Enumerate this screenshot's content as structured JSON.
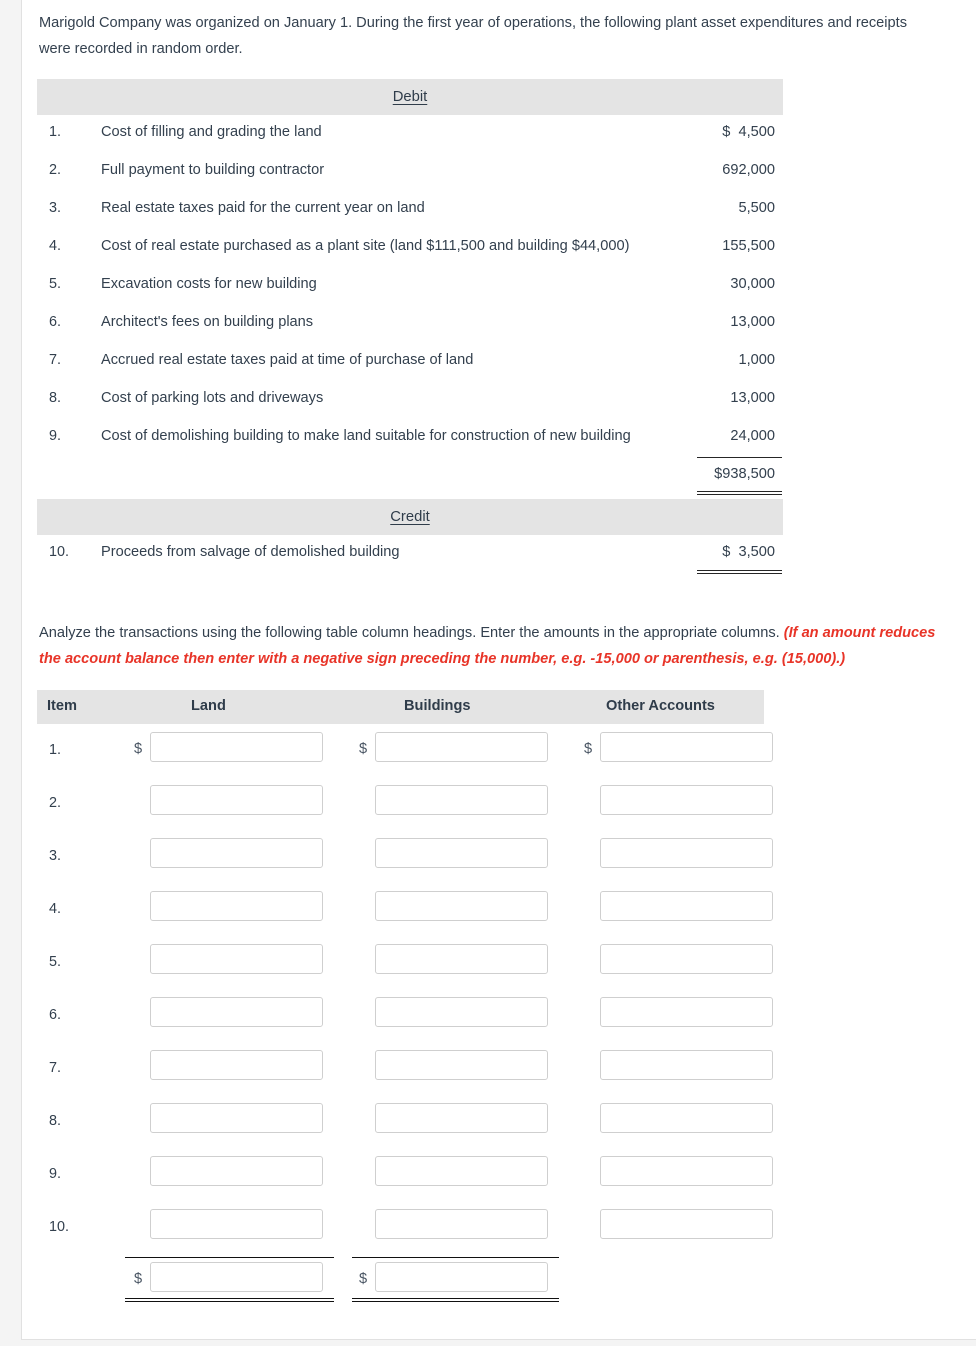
{
  "intro": "Marigold Company was organized on January 1. During the first year of operations, the following plant asset expenditures and receipts were recorded in random order.",
  "listing": {
    "debit_header": "Debit",
    "credit_header": "Credit",
    "debit_rows": [
      {
        "num": "1.",
        "text": "Cost of filling and grading the land",
        "amount": "$  4,500"
      },
      {
        "num": "2.",
        "text": "Full payment to building contractor",
        "amount": "692,000"
      },
      {
        "num": "3.",
        "text": "Real estate taxes paid for the current year on land",
        "amount": "5,500"
      },
      {
        "num": "4.",
        "text": "Cost of real estate purchased as a plant site (land $111,500 and building $44,000)",
        "amount": "155,500"
      },
      {
        "num": "5.",
        "text": "Excavation costs for new building",
        "amount": "30,000"
      },
      {
        "num": "6.",
        "text": "Architect's fees on building plans",
        "amount": "13,000"
      },
      {
        "num": "7.",
        "text": "Accrued real estate taxes paid at time of purchase of land",
        "amount": "1,000"
      },
      {
        "num": "8.",
        "text": "Cost of parking lots and driveways",
        "amount": "13,000"
      },
      {
        "num": "9.",
        "text": "Cost of demolishing building to make land suitable for construction of new building",
        "amount": "24,000"
      }
    ],
    "debit_total": "$938,500",
    "credit_rows": [
      {
        "num": "10.",
        "text": "Proceeds from salvage of demolished building",
        "amount": "$  3,500"
      }
    ]
  },
  "analyze": {
    "text": "Analyze the transactions using the following table column headings. Enter the amounts in the appropriate columns.",
    "note": "(If an amount reduces the account balance then enter with a negative sign preceding the number, e.g. -15,000 or parenthesis, e.g. (15,000).)",
    "note_color": "#e83428"
  },
  "entry_table": {
    "headers": {
      "item": "Item",
      "land": "Land",
      "buildings": "Buildings",
      "other": "Other Accounts"
    },
    "currency_symbol": "$",
    "input_placeholder": "",
    "rows": [
      {
        "num": "1.",
        "land": "",
        "buildings": "",
        "other": ""
      },
      {
        "num": "2.",
        "land": "",
        "buildings": "",
        "other": ""
      },
      {
        "num": "3.",
        "land": "",
        "buildings": "",
        "other": ""
      },
      {
        "num": "4.",
        "land": "",
        "buildings": "",
        "other": ""
      },
      {
        "num": "5.",
        "land": "",
        "buildings": "",
        "other": ""
      },
      {
        "num": "6.",
        "land": "",
        "buildings": "",
        "other": ""
      },
      {
        "num": "7.",
        "land": "",
        "buildings": "",
        "other": ""
      },
      {
        "num": "8.",
        "land": "",
        "buildings": "",
        "other": ""
      },
      {
        "num": "9.",
        "land": "",
        "buildings": "",
        "other": ""
      },
      {
        "num": "10.",
        "land": "",
        "buildings": "",
        "other": ""
      }
    ],
    "total_row": {
      "land": "",
      "buildings": ""
    }
  }
}
